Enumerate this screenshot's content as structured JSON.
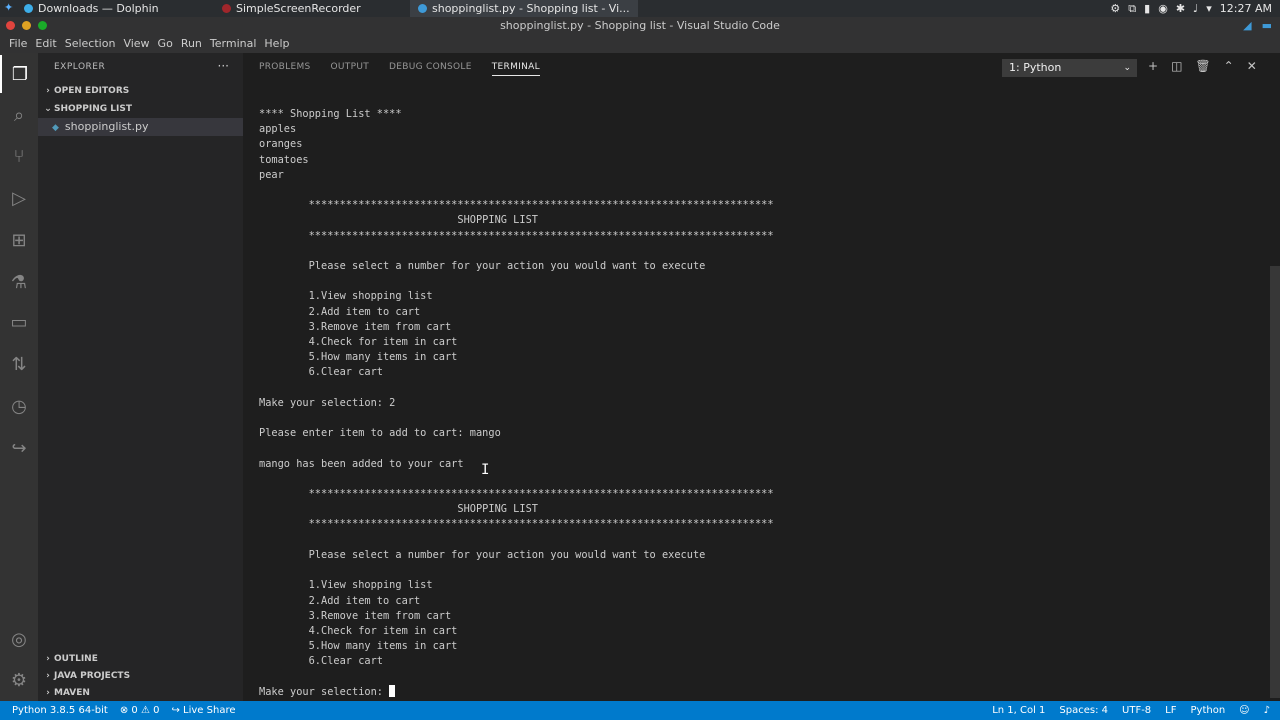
{
  "os_taskbar": {
    "tasks": [
      {
        "label": "Downloads — Dolphin",
        "color": "#3daee9"
      },
      {
        "label": "SimpleScreenRecorder",
        "color": "#a0262b"
      },
      {
        "label": "shoppinglist.py - Shopping list - Vi...",
        "color": "#3e9ad8"
      }
    ],
    "clock": "12:27 AM"
  },
  "window": {
    "title": "shoppinglist.py - Shopping list - Visual Studio Code",
    "dot_colors": [
      "#e0443e",
      "#dea123",
      "#1aab29"
    ]
  },
  "menu": [
    "File",
    "Edit",
    "Selection",
    "View",
    "Go",
    "Run",
    "Terminal",
    "Help"
  ],
  "activity_bar": {
    "icons": [
      "files-icon",
      "search-icon",
      "source-control-icon",
      "run-debug-icon",
      "extensions-icon",
      "testing-icon",
      "remote-explorer-icon",
      "pull-request-icon",
      "timeline-icon",
      "live-share-icon",
      "accounts-icon",
      "settings-icon"
    ]
  },
  "sidebar": {
    "header": "EXPLORER",
    "more": "···",
    "open_editors": "OPEN EDITORS",
    "folder": "SHOPPING LIST",
    "file": "shoppinglist.py",
    "outline": "OUTLINE",
    "java_projects": "JAVA PROJECTS",
    "maven": "MAVEN"
  },
  "panel": {
    "tabs": [
      "PROBLEMS",
      "OUTPUT",
      "DEBUG CONSOLE",
      "TERMINAL"
    ],
    "active_tab": "TERMINAL",
    "terminal_select": "1: Python"
  },
  "terminal_lines": [
    "**** Shopping List ****",
    "apples",
    "oranges",
    "tomatoes",
    "pear",
    "",
    "        ***************************************************************************",
    "                                SHOPPING LIST",
    "        ***************************************************************************",
    "",
    "        Please select a number for your action you would want to execute",
    "",
    "        1.View shopping list",
    "        2.Add item to cart",
    "        3.Remove item from cart",
    "        4.Check for item in cart",
    "        5.How many items in cart",
    "        6.Clear cart",
    "",
    "Make your selection: 2",
    "",
    "Please enter item to add to cart: mango",
    "",
    "mango has been added to your cart",
    "",
    "        ***************************************************************************",
    "                                SHOPPING LIST",
    "        ***************************************************************************",
    "",
    "        Please select a number for your action you would want to execute",
    "",
    "        1.View shopping list",
    "        2.Add item to cart",
    "        3.Remove item from cart",
    "        4.Check for item in cart",
    "        5.How many items in cart",
    "        6.Clear cart",
    "",
    "Make your selection: "
  ],
  "status_bar": {
    "python": "Python 3.8.5 64-bit",
    "problems": "⊗ 0 ⚠ 0",
    "live_share": "Live Share",
    "position": "Ln 1, Col 1",
    "spaces": "Spaces: 4",
    "encoding": "UTF-8",
    "eol": "LF",
    "language": "Python"
  }
}
